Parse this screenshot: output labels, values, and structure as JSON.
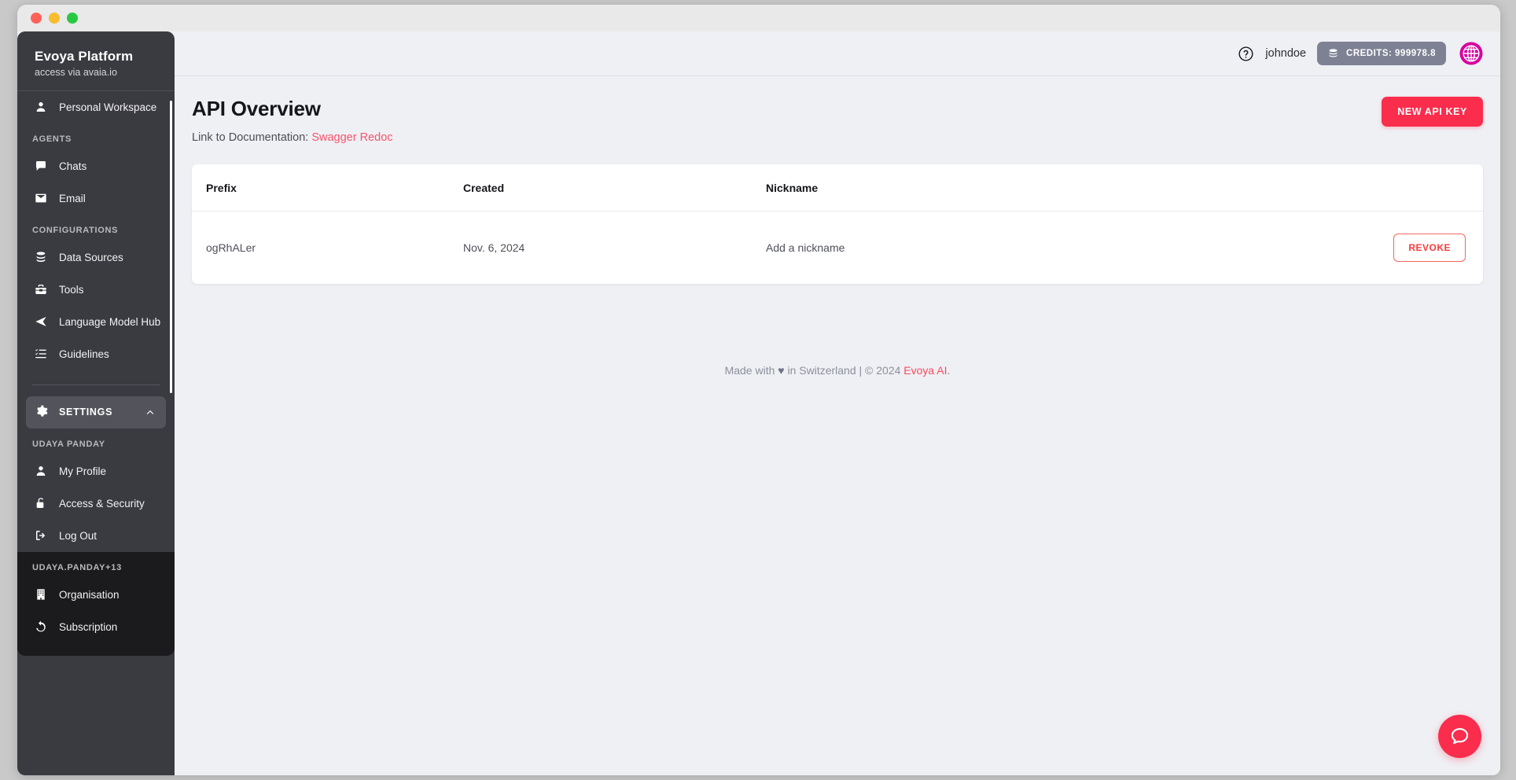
{
  "window": {
    "traffic_lights": [
      "close",
      "minimize",
      "zoom"
    ]
  },
  "sidebar": {
    "brand": {
      "title": "Evoya Platform",
      "subtitle": "access via avaia.io"
    },
    "workspace": {
      "label": "Personal Workspace",
      "icon": "person-icon"
    },
    "sections": [
      {
        "label": "AGENTS",
        "items": [
          {
            "label": "Chats",
            "icon": "chat-bubble-icon"
          },
          {
            "label": "Email",
            "icon": "envelope-icon"
          }
        ]
      },
      {
        "label": "CONFIGURATIONS",
        "items": [
          {
            "label": "Data Sources",
            "icon": "database-icon"
          },
          {
            "label": "Tools",
            "icon": "toolbox-icon"
          },
          {
            "label": "Language Model Hub",
            "icon": "send-icon"
          },
          {
            "label": "Guidelines",
            "icon": "checklist-icon"
          }
        ]
      }
    ],
    "settings": {
      "label": "SETTINGS",
      "icon": "gear-icon",
      "chevron": "chevron-up-icon",
      "expanded": true
    },
    "user_section": {
      "label": "UDAYA PANDAY",
      "items": [
        {
          "label": "My Profile",
          "icon": "person-icon"
        },
        {
          "label": "Access & Security",
          "icon": "lock-open-icon"
        },
        {
          "label": "Log Out",
          "icon": "logout-icon"
        }
      ]
    },
    "org_section": {
      "label": "UDAYA.PANDAY+13",
      "items": [
        {
          "label": "Organisation",
          "icon": "building-icon"
        },
        {
          "label": "Subscription",
          "icon": "refresh-icon"
        }
      ]
    }
  },
  "topbar": {
    "help_icon": "question-circle-icon",
    "username": "johndoe",
    "credits": {
      "icon": "coins-icon",
      "label": "CREDITS: 999978.8"
    },
    "avatar": "globe-avatar"
  },
  "main": {
    "title": "API Overview",
    "doc_prefix": "Link to Documentation:",
    "doc_links": [
      "Swagger",
      "Redoc"
    ],
    "new_key_button": "NEW API KEY",
    "table": {
      "columns": [
        "Prefix",
        "Created",
        "Nickname",
        ""
      ],
      "rows": [
        {
          "prefix": "ogRhALer",
          "created": "Nov. 6, 2024",
          "nickname_placeholder": "Add a nickname",
          "action": "REVOKE"
        }
      ]
    }
  },
  "footer": {
    "prefix": "Made with",
    "heart": "♥",
    "middle": "in Switzerland | © 2024",
    "brand": "Evoya AI",
    "suffix": "."
  },
  "fab": {
    "icon": "chat-bubble-icon"
  },
  "colors": {
    "accent_red": "#fa2d4c",
    "link_red": "#f9536b",
    "sidebar_bg": "#3a3b41",
    "sidebar_lower_bg": "#1b1b1d",
    "credits_pill": "#7e8193",
    "page_bg": "#eff0f4",
    "avatar_magenta": "#d6009f"
  }
}
